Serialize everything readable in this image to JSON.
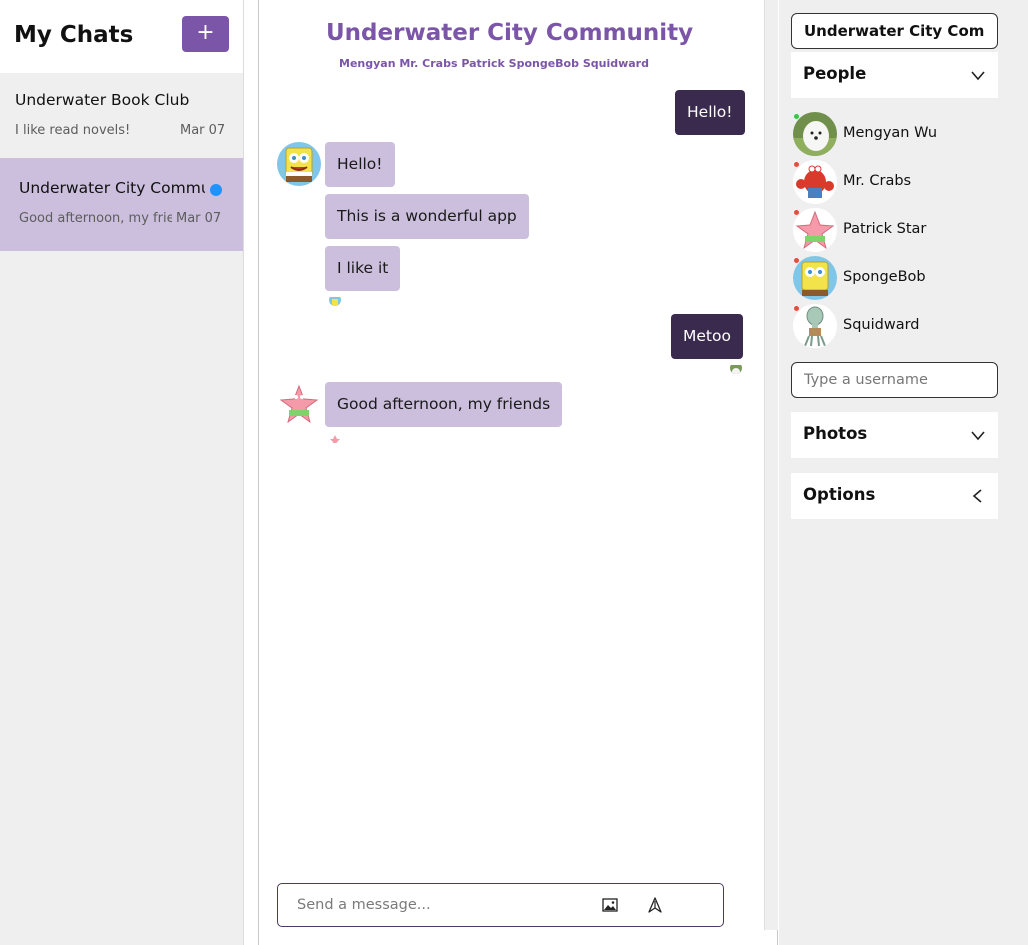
{
  "sidebar": {
    "title": "My Chats",
    "new_chat_label": "+",
    "chats": [
      {
        "name": "Underwater Book Club",
        "preview": "I like read novels!",
        "date": "Mar 07",
        "unread": false,
        "selected": false
      },
      {
        "name": "Underwater City Community",
        "preview": "Good afternoon, my friends",
        "date": "Mar 07",
        "unread": true,
        "selected": true
      }
    ]
  },
  "chat": {
    "title": "Underwater City Community",
    "members_line": "Mengyan Mr. Crabs Patrick SpongeBob Squidward",
    "messages": [
      {
        "sender": "Mengyan Wu",
        "text": "Hello!",
        "mine": true
      },
      {
        "sender": "SpongeBob",
        "text": "Hello!",
        "mine": false
      },
      {
        "sender": "SpongeBob",
        "text": "This is a wonderful app",
        "mine": false
      },
      {
        "sender": "SpongeBob",
        "text": "I like it",
        "mine": false
      },
      {
        "sender": "Mengyan Wu",
        "text": "Metoo",
        "mine": true
      },
      {
        "sender": "Patrick Star",
        "text": "Good afternoon, my friends",
        "mine": false
      }
    ],
    "composer": {
      "placeholder": "Send a message...",
      "image_icon": "image-icon",
      "send_icon": "send-icon"
    }
  },
  "settings": {
    "chat_title_value": "Underwater City Community",
    "people_label": "People",
    "people": [
      {
        "name": "Mengyan Wu",
        "status_color": "#2ecc40"
      },
      {
        "name": "Mr. Crabs",
        "status_color": "#e74c3c"
      },
      {
        "name": "Patrick Star",
        "status_color": "#e74c3c"
      },
      {
        "name": "SpongeBob",
        "status_color": "#e74c3c"
      },
      {
        "name": "Squidward",
        "status_color": "#e74c3c"
      }
    ],
    "add_user_placeholder": "Type a username",
    "photos_label": "Photos",
    "options_label": "Options"
  },
  "colors": {
    "accent": "#7b55a8",
    "my_bubble": "#3a2a4d",
    "their_bubble": "#cbbfdd",
    "unread_dot": "#1f93ff"
  }
}
